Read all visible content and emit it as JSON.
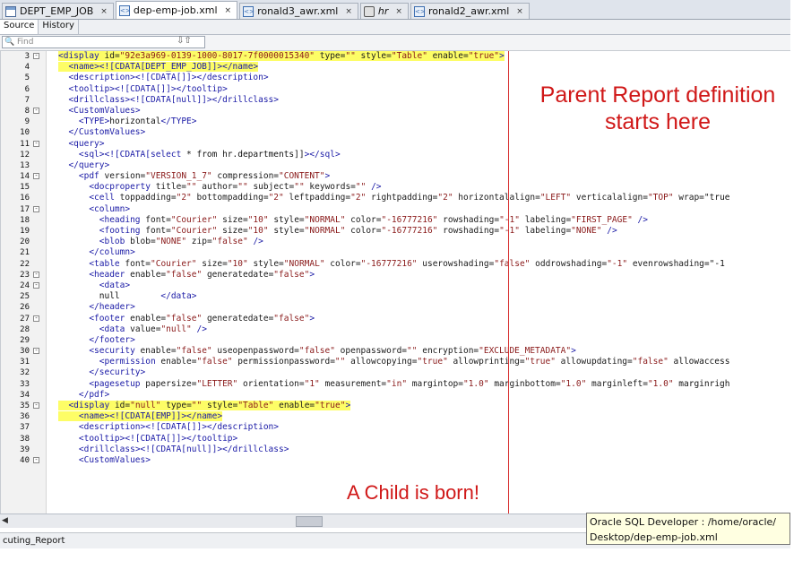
{
  "tabs": [
    {
      "label": "DEPT_EMP_JOB",
      "icon": "table-icon",
      "italic": false,
      "active": false
    },
    {
      "label": "dep-emp-job.xml",
      "icon": "xml-file-icon",
      "italic": false,
      "active": true
    },
    {
      "label": "ronald3_awr.xml",
      "icon": "xml-file-icon",
      "italic": false,
      "active": false
    },
    {
      "label": "hr",
      "icon": "database-connection-icon",
      "italic": true,
      "active": false
    },
    {
      "label": "ronald2_awr.xml",
      "icon": "xml-file-icon",
      "italic": false,
      "active": false
    }
  ],
  "close_glyph": "×",
  "subtabs": {
    "source": "Source",
    "history": "History"
  },
  "find": {
    "placeholder": "Find",
    "arrows": "⇩⇧"
  },
  "line_numbers": [
    "3",
    "4",
    "5",
    "6",
    "7",
    "8",
    "9",
    "10",
    "11",
    "12",
    "13",
    "14",
    "15",
    "16",
    "17",
    "18",
    "19",
    "20",
    "21",
    "22",
    "23",
    "24",
    "25",
    "26",
    "27",
    "28",
    "29",
    "30",
    "31",
    "32",
    "33",
    "34",
    "35",
    "36",
    "37",
    "38",
    "39",
    "40"
  ],
  "code_lines": [
    "<display id=\"92e3a969-0139-1000-8017-7f0000015340\" type=\"\" style=\"Table\" enable=\"true\">",
    "  <name><![CDATA[DEPT_EMP_JOB]]></name>",
    "  <description><![CDATA[]]></description>",
    "  <tooltip><![CDATA[]]></tooltip>",
    "  <drillclass><![CDATA[null]]></drillclass>",
    "  <CustomValues>",
    "    <TYPE>horizontal</TYPE>",
    "  </CustomValues>",
    "  <query>",
    "    <sql><![CDATA[select * from hr.departments]]></sql>",
    "  </query>",
    "    <pdf version=\"VERSION_1_7\" compression=\"CONTENT\">",
    "      <docproperty title=\"\" author=\"\" subject=\"\" keywords=\"\" />",
    "      <cell toppadding=\"2\" bottompadding=\"2\" leftpadding=\"2\" rightpadding=\"2\" horizontalalign=\"LEFT\" verticalalign=\"TOP\" wrap=\"true",
    "      <column>",
    "        <heading font=\"Courier\" size=\"10\" style=\"NORMAL\" color=\"-16777216\" rowshading=\"-1\" labeling=\"FIRST_PAGE\" />",
    "        <footing font=\"Courier\" size=\"10\" style=\"NORMAL\" color=\"-16777216\" rowshading=\"-1\" labeling=\"NONE\" />",
    "        <blob blob=\"NONE\" zip=\"false\" />",
    "      </column>",
    "      <table font=\"Courier\" size=\"10\" style=\"NORMAL\" color=\"-16777216\" userowshading=\"false\" oddrowshading=\"-1\" evenrowshading=\"-1",
    "      <header enable=\"false\" generatedate=\"false\">",
    "        <data>",
    "        null        </data>",
    "      </header>",
    "      <footer enable=\"false\" generatedate=\"false\">",
    "        <data value=\"null\" />",
    "      </footer>",
    "      <security enable=\"false\" useopenpassword=\"false\" openpassword=\"\" encryption=\"EXCLUDE_METADATA\">",
    "        <permission enable=\"false\" permissionpassword=\"\" allowcopying=\"true\" allowprinting=\"true\" allowupdating=\"false\" allowaccess",
    "      </security>",
    "      <pagesetup papersize=\"LETTER\" orientation=\"1\" measurement=\"in\" margintop=\"1.0\" marginbottom=\"1.0\" marginleft=\"1.0\" marginrigh",
    "    </pdf>",
    "  <display id=\"null\" type=\"\" style=\"Table\" enable=\"true\">",
    "    <name><![CDATA[EMP]]></name>",
    "    <description><![CDATA[]]></description>",
    "    <tooltip><![CDATA[]]></tooltip>",
    "    <drillclass><![CDATA[null]]></drillclass>",
    "    <CustomValues>"
  ],
  "fold_lines": [
    "3",
    "8",
    "11",
    "14",
    "17",
    "23",
    "24",
    "27",
    "30",
    "35",
    "40"
  ],
  "highlight_lines": [
    "3",
    "4",
    "35",
    "36"
  ],
  "annotations": {
    "parent": "Parent Report definition starts here",
    "child": "A Child is born!"
  },
  "status": {
    "left_text": "cuting_Report"
  },
  "tooltip": {
    "line1": "Oracle SQL Developer : /home/oracle/",
    "line2": "Desktop/dep-emp-job.xml"
  },
  "colors": {
    "annotation": "#d01818",
    "highlight": "#fdfd66",
    "tag": "#1a1aa6",
    "value": "#8a1a1a"
  }
}
